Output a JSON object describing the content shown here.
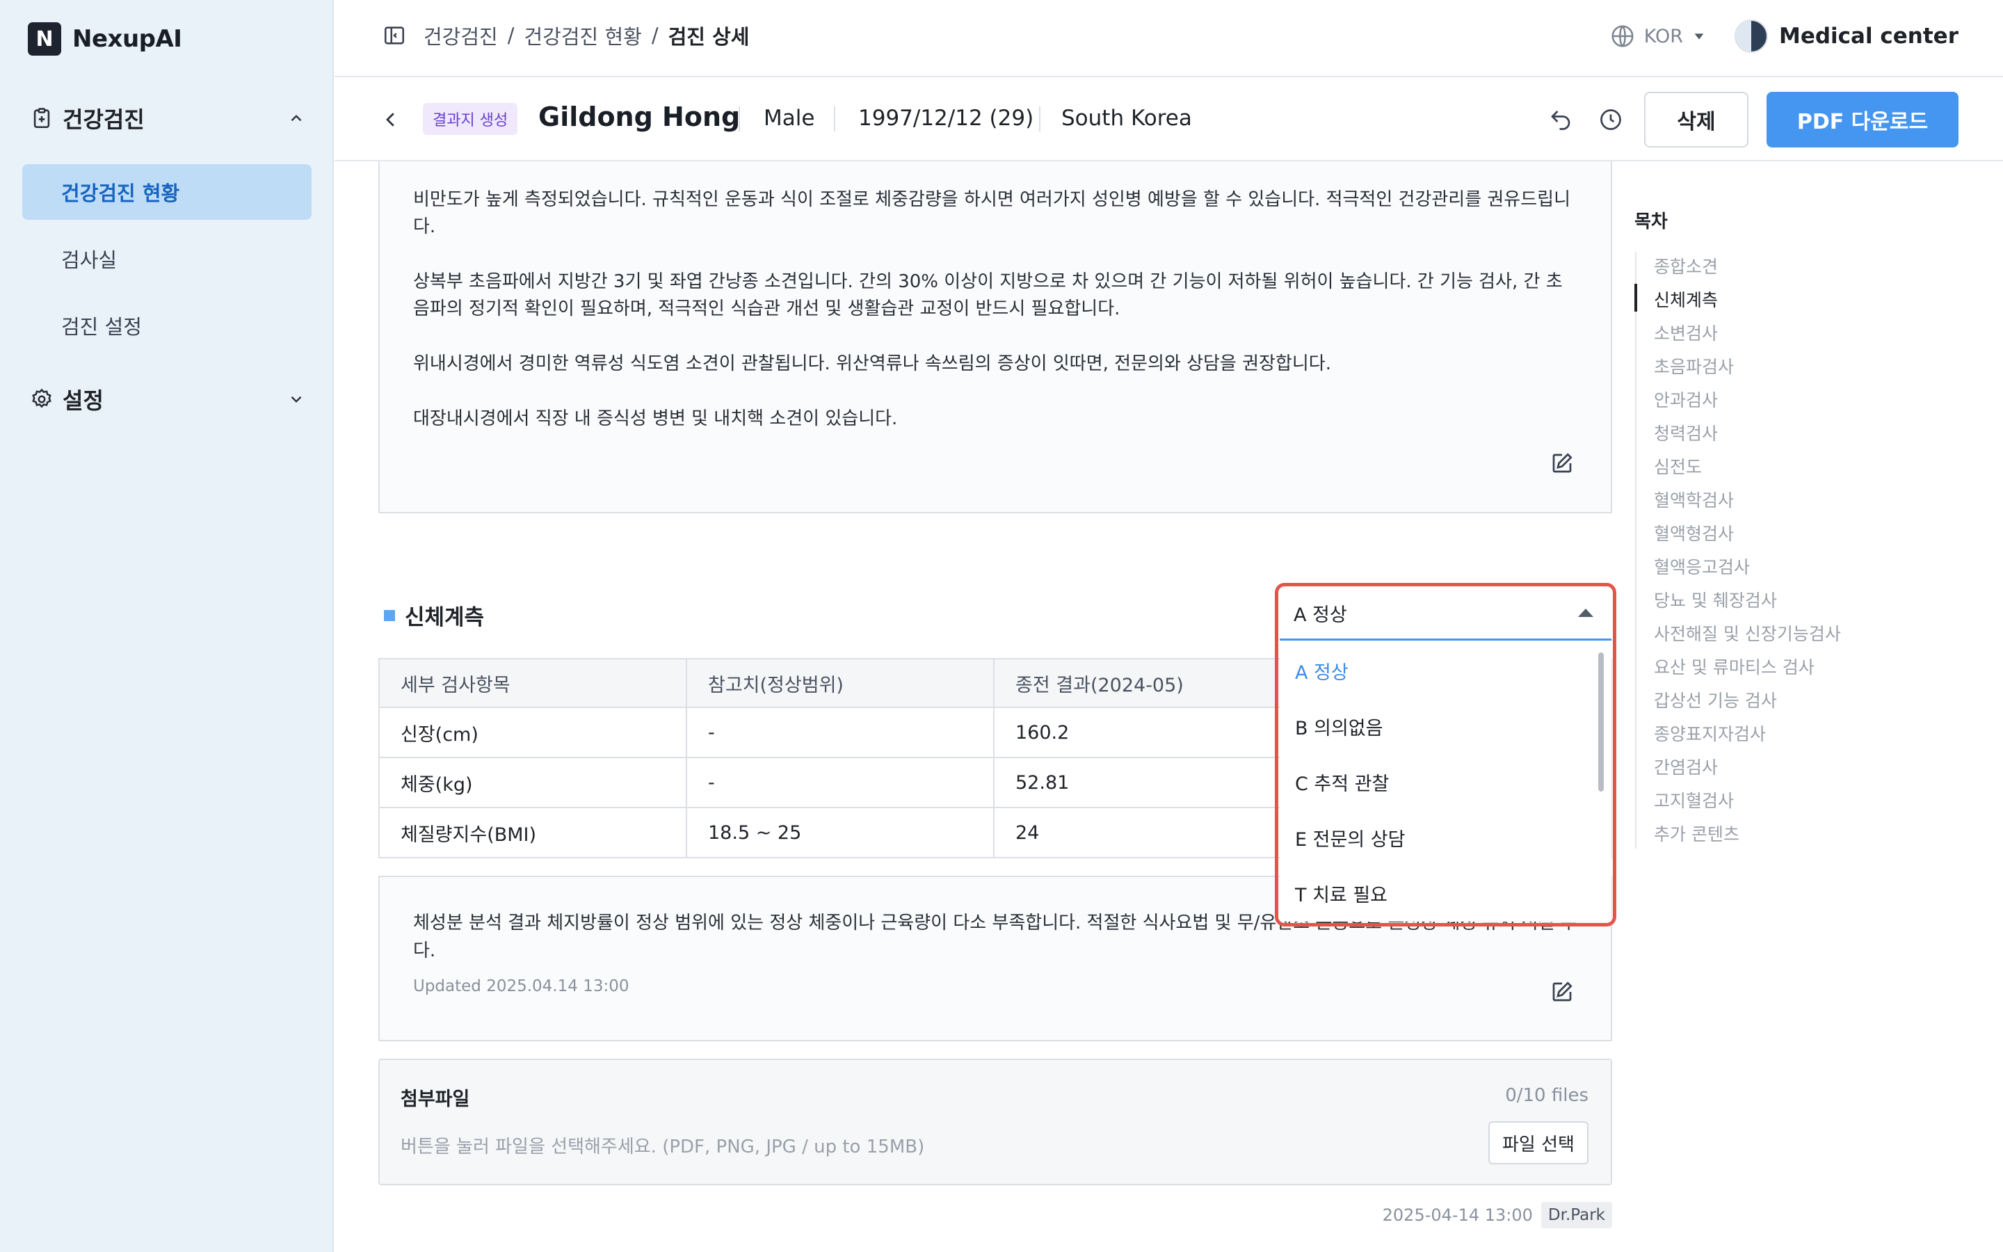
{
  "app": {
    "name": "NexupAI"
  },
  "sidebar": {
    "groups": [
      {
        "label": "건강검진",
        "icon": "clipboard-plus-icon",
        "expanded": true,
        "items": [
          {
            "label": "건강검진 현황",
            "active": true
          },
          {
            "label": "검사실"
          },
          {
            "label": "검진 설정"
          }
        ]
      },
      {
        "label": "설정",
        "icon": "gear-icon",
        "expanded": false
      }
    ]
  },
  "topbar": {
    "breadcrumb": [
      "건강검진",
      "건강검진 현황",
      "검진 상세"
    ],
    "language": "KOR",
    "org": "Medical center"
  },
  "patient": {
    "badge": "결과지 생성",
    "name": "Gildong Hong",
    "sex": "Male",
    "dob": "1997/12/12 (29)",
    "country": "South Korea"
  },
  "actions": {
    "delete": "삭제",
    "pdf": "PDF 다운로드"
  },
  "summary": [
    "비만도가 높게 측정되었습니다. 규칙적인 운동과 식이 조절로 체중감량을 하시면 여러가지 성인병 예방을 할 수 있습니다. 적극적인 건강관리를 권유드립니다.",
    "상복부 초음파에서 지방간 3기 및 좌엽 간낭종 소견입니다. 간의 30% 이상이 지방으로 차 있으며 간 기능이 저하될 위허이 높습니다. 간 기능 검사, 간 초음파의 정기적 확인이 필요하며, 적극적인 식습관 개선 및 생활습관 교정이 반드시 필요합니다.",
    "위내시경에서 경미한 역류성 식도염 소견이 관찰됩니다. 위산역류나 속쓰림의 증상이 잇따면, 전문의와 상담을 권장합니다.",
    "대장내시경에서 직장 내 증식성 병변 및 내치핵 소견이 있습니다."
  ],
  "section": {
    "title": "신체계측",
    "table": {
      "headers": [
        "세부 검사항목",
        "참고치(정상범위)",
        "종전 결과(2024-05)",
        ""
      ],
      "rows": [
        [
          "신장(cm)",
          "-",
          "160.2"
        ],
        [
          "체중(kg)",
          "-",
          "52.81"
        ],
        [
          "체질량지수(BMI)",
          "18.5 ~ 25",
          "24"
        ]
      ]
    },
    "result_text": "체성분 분석 결과 체지방률이 정상 범위에 있는 정상 체중이나 근육량이 다소 부족합니다. 적절한 식사요법 및 무/유산소 운동으로 근성장 계정 유지 적절 수 다.",
    "updated": "Updated 2025.04.14 13:00"
  },
  "dropdown": {
    "selected": "A 정상",
    "options": [
      "A 정상",
      "B 의의없음",
      "C 추적 관찰",
      "E 전문의 상담",
      "T 치료 필요"
    ]
  },
  "attachment": {
    "title": "첨부파일",
    "count": "0/10 files",
    "hint": "버튼을 눌러 파일을 선택해주세요. (PDF, PNG, JPG / up to 15MB)",
    "button": "파일 선택"
  },
  "footer": {
    "timestamp": "2025-04-14 13:00",
    "author": "Dr.Park"
  },
  "toc": {
    "title": "목차",
    "active": "신체계측",
    "items": [
      "종합소견",
      "신체계측",
      "소변검사",
      "초음파검사",
      "안과검사",
      "청력검사",
      "심전도",
      "혈액학검사",
      "혈액형검사",
      "혈액응고검사",
      "당뇨 및 췌장검사",
      "사전해질 및 신장기능검사",
      "요산 및 류마티스 검사",
      "갑상선 기능 검사",
      "종양표지자검사",
      "간염검사",
      "고지혈검사",
      "추가 콘텐츠"
    ]
  },
  "colors": {
    "accent": "#4596f0",
    "highlight": "#e5534b",
    "sidebar_bg": "#e9f1f9",
    "sidebar_active": "#bfdcf7"
  }
}
